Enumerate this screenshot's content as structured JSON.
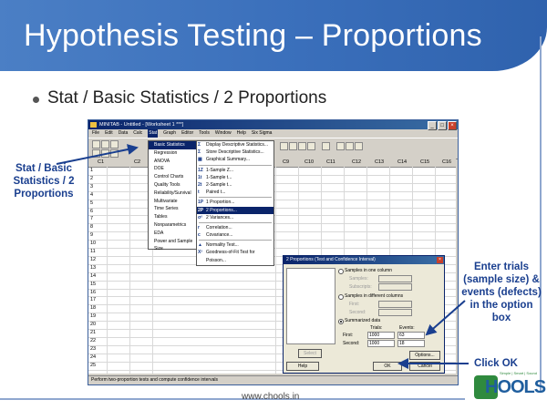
{
  "slide": {
    "title": "Hypothesis Testing – Proportions",
    "bullet": "Stat / Basic Statistics / 2 Proportions",
    "footer_url": "www.chools.in",
    "logo_text": "HOOLS",
    "logo_tagline": "Simple | Smart | Sound"
  },
  "callouts": {
    "left": [
      "Stat / Basic",
      "Statistics / 2",
      "Proportions"
    ],
    "right": [
      "Enter trials",
      "(sample size) &",
      "events (defects)",
      "in the option",
      "box"
    ],
    "click_ok": "Click OK"
  },
  "minitab": {
    "title": "MINITAB - Untitled - [Worksheet 1 ***]",
    "menu": [
      "File",
      "Edit",
      "Data",
      "Calc",
      "Stat",
      "Graph",
      "Editor",
      "Tools",
      "Window",
      "Help",
      "Six Sigma"
    ],
    "columns": [
      "C1",
      "C2",
      "C9",
      "C10",
      "C11",
      "C12",
      "C13",
      "C14",
      "C15",
      "C16"
    ],
    "rows": [
      "1",
      "2",
      "3",
      "4",
      "5",
      "6",
      "7",
      "8",
      "9",
      "10",
      "11",
      "12",
      "13",
      "14",
      "15",
      "16",
      "17",
      "18",
      "19",
      "20",
      "21",
      "22",
      "23",
      "24",
      "25"
    ],
    "status": "Perform two-proportion tests and compute confidence intervals"
  },
  "stat_menu": [
    "Basic Statistics",
    "Regression",
    "ANOVA",
    "DOE",
    "Control Charts",
    "Quality Tools",
    "Reliability/Survival",
    "Multivariate",
    "Time Series",
    "Tables",
    "Nonparametrics",
    "EDA",
    "Power and Sample Size"
  ],
  "basic_stats_menu": [
    {
      "icon": "Σ",
      "label": "Display Descriptive Statistics..."
    },
    {
      "icon": "Σ",
      "label": "Store Descriptive Statistics..."
    },
    {
      "icon": "▦",
      "label": "Graphical Summary..."
    },
    {
      "icon": "1Z",
      "label": "1-Sample Z..."
    },
    {
      "icon": "1t",
      "label": "1-Sample t..."
    },
    {
      "icon": "2t",
      "label": "2-Sample t..."
    },
    {
      "icon": "t",
      "label": "Paired t..."
    },
    {
      "icon": "1P",
      "label": "1 Proportion..."
    },
    {
      "icon": "2P",
      "label": "2 Proportions..."
    },
    {
      "icon": "σ²",
      "label": "2 Variances..."
    },
    {
      "icon": "r",
      "label": "Correlation..."
    },
    {
      "icon": "c",
      "label": "Covariance..."
    },
    {
      "icon": "▲",
      "label": "Normality Test..."
    },
    {
      "icon": "X²",
      "label": "Goodness-of-Fit Test for Poisson..."
    }
  ],
  "dialog": {
    "title": "2 Proportions (Test and Confidence Interval)",
    "opt_one_column": "Samples in one column",
    "samples_label": "Samples:",
    "subscripts_label": "Subscripts:",
    "opt_diff_columns": "Samples in different columns",
    "first_label": "First:",
    "second_label": "Second:",
    "opt_summarized": "Summarized data",
    "trials_header": "Trials:",
    "events_header": "Events:",
    "first_row_label": "First:",
    "second_row_label": "Second:",
    "first_trials": "1000",
    "first_events": "63",
    "second_trials": "1000",
    "second_events": "18",
    "select_btn": "Select",
    "options_btn": "Options...",
    "help_btn": "Help",
    "ok_btn": "OK",
    "cancel_btn": "Cancel"
  },
  "colors": {
    "title_bar": "#3a6fbb",
    "callout_text": "#1a3f8f",
    "menu_highlight": "#0a246a"
  }
}
